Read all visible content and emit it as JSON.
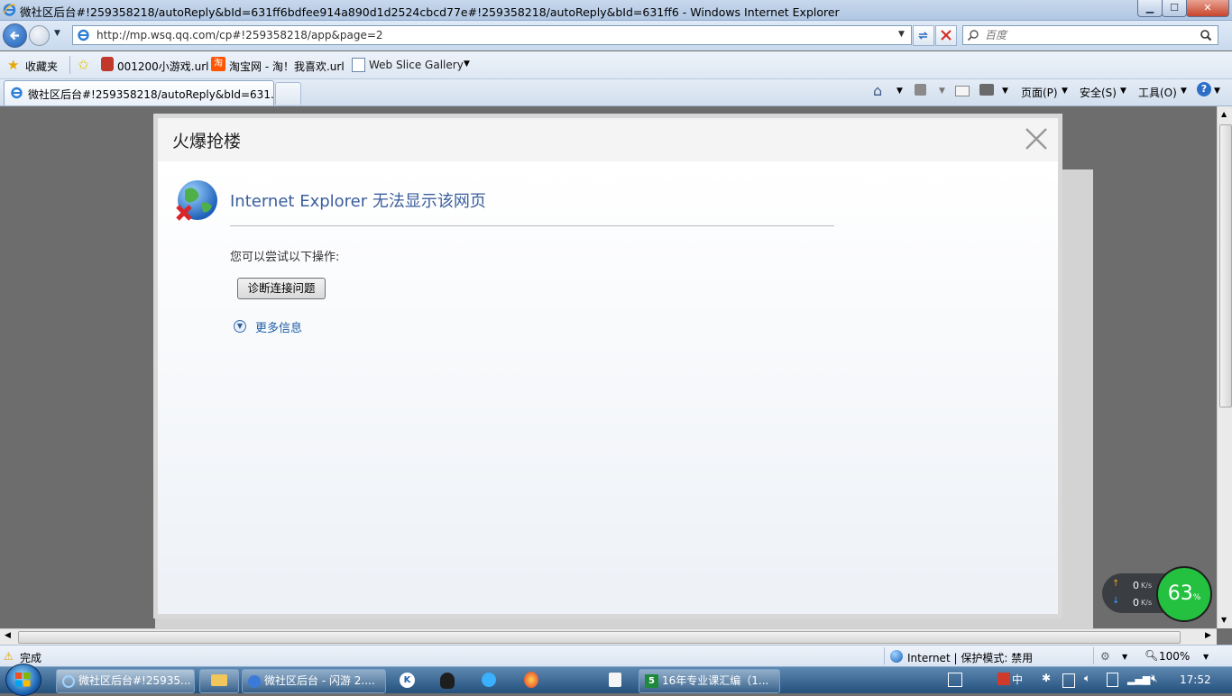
{
  "window": {
    "title": "微社区后台#!259358218/autoReply&bId=631ff6bdfee914a890d1d2524cbcd77e#!259358218/autoReply&bId=631ff6 - Windows Internet Explorer",
    "min": "▁",
    "max": "☐",
    "close": "✕"
  },
  "nav": {
    "url": "http://mp.wsq.qq.com/cp#!259358218/app&page=2",
    "search_placeholder": "百度"
  },
  "favorites": {
    "label": "收藏夹",
    "items": [
      "001200小游戏.url",
      "淘宝网 - 淘！我喜欢.url",
      "Web Slice Gallery"
    ]
  },
  "tabs": {
    "active_title": "微社区后台#!259358218/autoReply&bId=631..."
  },
  "commandbar": {
    "page": "页面(P)",
    "safety": "安全(S)",
    "tools": "工具(O)"
  },
  "dialog": {
    "title": "火爆抢楼",
    "error_title": "Internet Explorer 无法显示该网页",
    "hint": "您可以尝试以下操作:",
    "diagnose_button": "诊断连接问题",
    "more_info": "更多信息"
  },
  "statusbar": {
    "status": "完成",
    "zone": "Internet | 保护模式: 禁用",
    "zoom": "100%"
  },
  "netwidget": {
    "up": "0",
    "down": "0",
    "unit": "K/s",
    "percent": "63",
    "percent_sign": "%"
  },
  "taskbar": {
    "items": [
      "微社区后台#!25935...",
      "微社区后台 - 闪游 2....",
      "16年专业课汇编（1..."
    ],
    "clock": "17:52"
  },
  "colors": {
    "accent": "#3a5e9c",
    "link": "#1f5fa8",
    "net_green": "#23c13f"
  }
}
